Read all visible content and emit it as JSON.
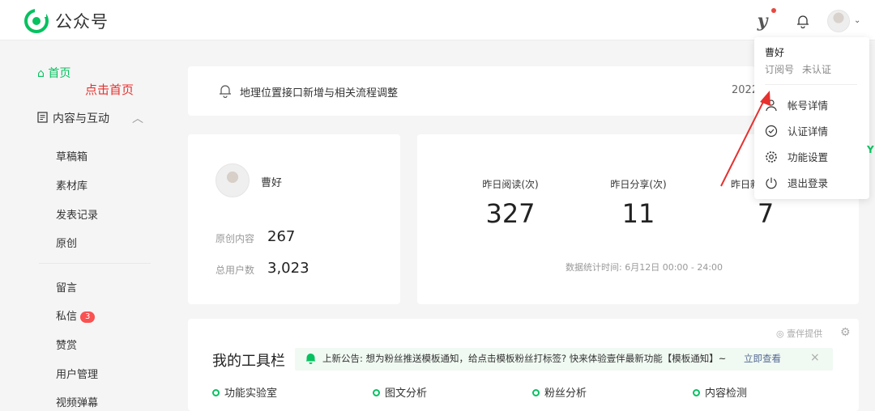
{
  "header": {
    "app_title": "公众号",
    "icons": [
      "wechat-logo",
      "y-icon",
      "bell-icon",
      "avatar"
    ],
    "accent": "#07c160"
  },
  "sidebar": {
    "home_label": "首页",
    "annotation": "点击首页",
    "content_section": "内容与互动",
    "items": [
      "草稿箱",
      "素材库",
      "发表记录",
      "原创",
      "留言",
      "私信",
      "赞赏",
      "用户管理",
      "视频弹幕"
    ],
    "message_badge": "3"
  },
  "notice": {
    "text": "地理位置接口新增与相关流程调整",
    "date": "2022"
  },
  "account": {
    "name": "曹好",
    "original_label": "原创内容",
    "original_value": "267",
    "users_label": "总用户数",
    "users_value": "3,023"
  },
  "stats": {
    "reads_label": "昨日阅读(次)",
    "reads_value": "327",
    "shares_label": "昨日分享(次)",
    "shares_value": "11",
    "third_label": "昨日新",
    "third_value": "7",
    "time_text": "数据统计时间: 6月12日 00:00 - 24:00"
  },
  "tools": {
    "title": "我的工具栏",
    "provider": "壹伴提供",
    "announcement": "上新公告: 想为粉丝推送模板通知，给点击模板粉丝打标签? 快来体验壹伴最新功能【模板通知】~",
    "announcement_link": "立即查看",
    "close": "×",
    "items": [
      "功能实验室",
      "图文分析",
      "粉丝分析",
      "内容检测"
    ]
  },
  "dropdown": {
    "name": "曹好",
    "type": "订阅号",
    "status": "未认证",
    "items": [
      "帐号详情",
      "认证详情",
      "功能设置",
      "退出登录"
    ]
  },
  "edge_tip": "Y"
}
